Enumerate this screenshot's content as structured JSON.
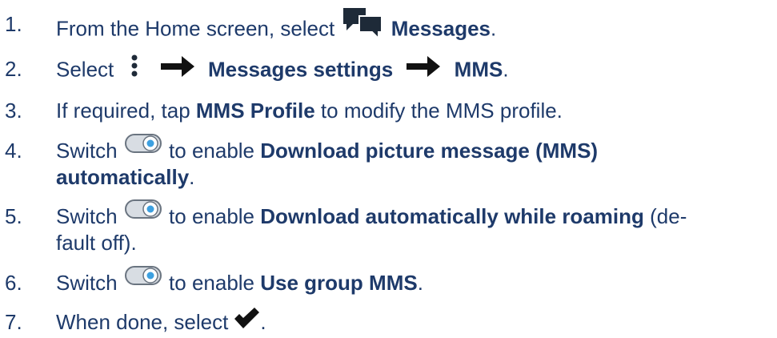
{
  "steps": [
    {
      "number": "1.",
      "parts": [
        "From the Home screen, select",
        "Messages",
        "."
      ],
      "icons": [
        "messages-icon"
      ]
    },
    {
      "number": "2.",
      "parts": [
        "Select",
        "Messages settings",
        "MMS",
        "."
      ],
      "icons": [
        "more-options-icon",
        "arrow-right-icon",
        "arrow-right-icon"
      ]
    },
    {
      "number": "3.",
      "parts": [
        "If required, tap ",
        "MMS Profile",
        " to modify the MMS profile."
      ]
    },
    {
      "number": "4.",
      "parts": [
        "Switch",
        " to enable ",
        "Download picture message (MMS)",
        "automatically",
        "."
      ],
      "icons": [
        "toggle-switch-icon"
      ]
    },
    {
      "number": "5.",
      "parts": [
        "Switch",
        " to enable ",
        "Download automatically while roaming",
        " (de-",
        "fault off)."
      ],
      "icons": [
        "toggle-switch-icon"
      ]
    },
    {
      "number": "6.",
      "parts": [
        "Switch",
        " to enable ",
        "Use group MMS",
        "."
      ],
      "icons": [
        "toggle-switch-icon"
      ]
    },
    {
      "number": "7.",
      "parts": [
        "When done, select",
        "."
      ],
      "icons": [
        "checkmark-icon"
      ]
    }
  ],
  "colors": {
    "text": "#1e3a6a",
    "icon": "#1e2a38",
    "toggle_knob": "#3da0e0"
  }
}
